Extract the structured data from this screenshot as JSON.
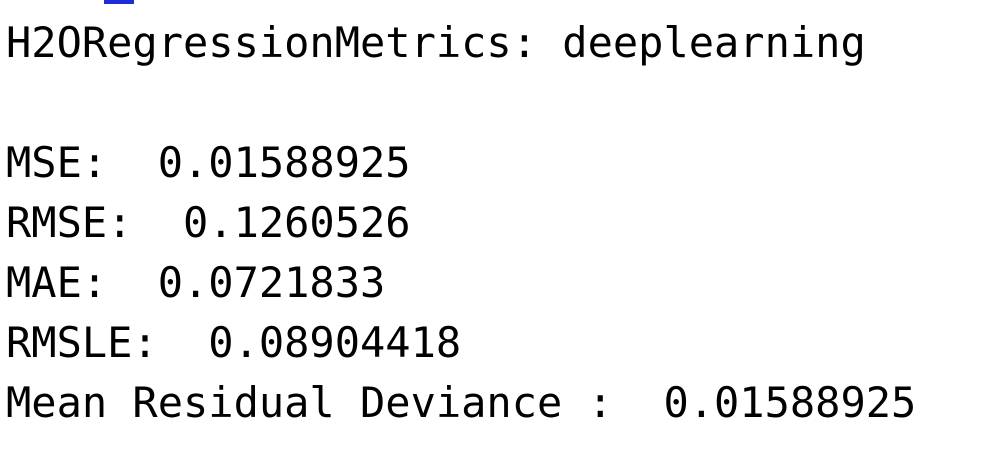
{
  "console": {
    "header": "H2ORegressionMetrics: deeplearning",
    "metrics": [
      {
        "text": "MSE:  0.01588925"
      },
      {
        "text": "RMSE:  0.1260526"
      },
      {
        "text": "MAE:  0.0721833"
      },
      {
        "text": "RMSLE:  0.08904418"
      },
      {
        "text": "Mean Residual Deviance :  0.01588925"
      }
    ]
  },
  "colors": {
    "background": "#ffffff",
    "text": "#000000",
    "cut_prompt": "#1f2bd6"
  }
}
